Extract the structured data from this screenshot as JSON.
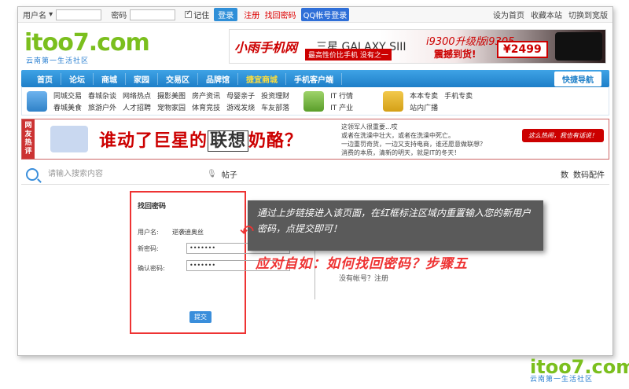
{
  "topbar": {
    "username_label": "用户名",
    "password_label": "密码",
    "remember_label": "记住",
    "login_button": "登录",
    "register_link": "注册",
    "find_password_link": "找回密码",
    "qq_login": "QQ帐号登录",
    "links": [
      "设为首页",
      "收藏本站",
      "切换到宽版"
    ]
  },
  "header": {
    "logo_text": "itoo7.com",
    "logo_sub": "云南第一生活社区",
    "banner": {
      "brand": "小雨手机网",
      "brand_sub": "小雨手机网",
      "product": "三星 GALAXY SIII",
      "product_sub": "最高性价比手机 没有之一",
      "model": "i9300升级版i9305",
      "ship": "震撼到货!",
      "price": "¥2499"
    }
  },
  "nav": {
    "items": [
      "首页",
      "论坛",
      "商城",
      "家园",
      "交易区",
      "品牌馆",
      "捷宜商城",
      "手机客户端"
    ],
    "quick": "快捷导航"
  },
  "subnav": {
    "group1": [
      "同城交易",
      "春城杂谈",
      "网络热点",
      "摄影美图",
      "房产资讯",
      "母婴亲子",
      "春城美食",
      "旅游户外",
      "人才招聘",
      "宠物家园",
      "体育竞技",
      "游戏发烧"
    ],
    "group1_extra": [
      "投资理财",
      "车友部落"
    ],
    "group2": [
      "IT 行情",
      "IT 产业"
    ],
    "group3": [
      "本本专卖",
      "手机专卖",
      "站内广播"
    ]
  },
  "hot": {
    "tag": "网友热评",
    "slogan_pre": "谁动了巨星的",
    "slogan_brand": "联想",
    "slogan_post": "奶酪？",
    "desc": [
      "这领军人很重要...哎",
      "或者在洗澡中壮大，或者在洗澡中死亡。",
      "一边重罚奇货，一边又支持电商，谁还愿意做联想？",
      "消费的本质，清新的明天，就是IT的冬天！"
    ],
    "button": "这么热闹，我也有话说！"
  },
  "search": {
    "placeholder": "请输入搜索内容",
    "tab": "帖子",
    "right_links": [
      "数",
      "数码配件"
    ]
  },
  "form": {
    "title": "找回密码",
    "username_label": "用户名:",
    "username_value": "逆袭迪奥丝",
    "new_password_label": "新密码:",
    "new_password_value": "•••••••",
    "confirm_password_label": "确认密码:",
    "confirm_password_value": "•••••••",
    "submit": "提交"
  },
  "overlay": {
    "note": "通过上步链接进入该页面，在红框标注区域内重置输入您的新用户密码，点提交即可！",
    "step": "应对自如：如何找回密码？步骤五",
    "behind_text": "没有帐号？注册"
  },
  "watermark": {
    "text": "itoo7.com",
    "sub": "云南第一生活社区"
  }
}
